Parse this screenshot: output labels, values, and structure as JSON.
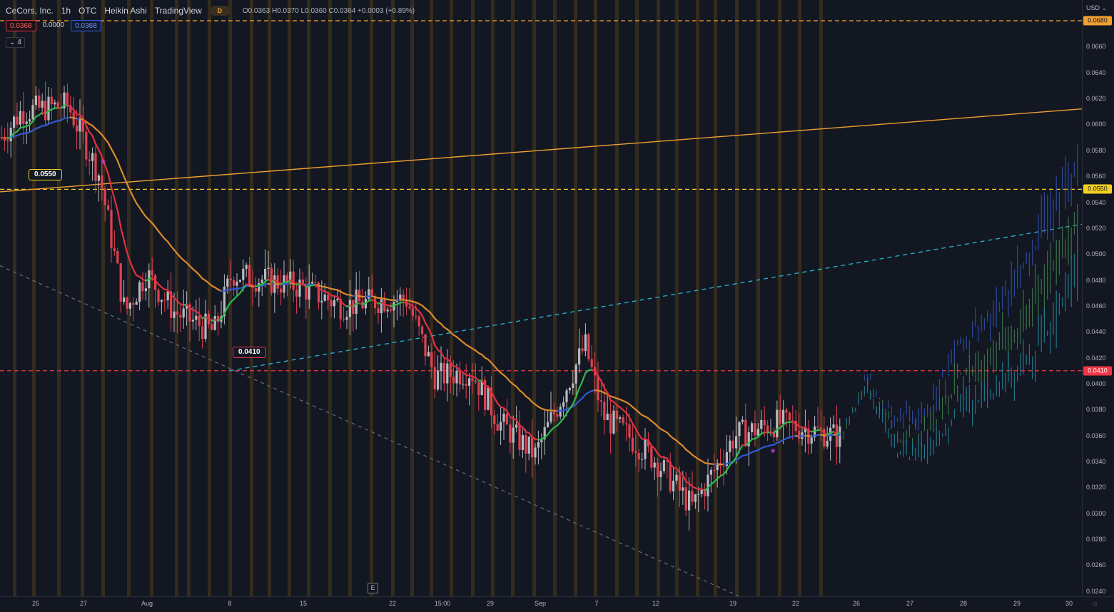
{
  "header": {
    "symbol": "CeCors, Inc.",
    "interval": "1h",
    "exchange": "OTC",
    "chart_type": "Heikin Ashi",
    "source": "TradingView",
    "delayed_badge": "D",
    "ohlc": "O0.0363 H0.0370 L0.0360 C0.0364 +0.0003 (+0.89%)"
  },
  "indicator_row": {
    "value_red": "0.0368",
    "value_plain": "0.0000",
    "value_blue": "0.0368",
    "collapse_count": "4"
  },
  "price_axis": {
    "currency": "USD",
    "ticks": [
      "0.0660",
      "0.0640",
      "0.0620",
      "0.0600",
      "0.0580",
      "0.0560",
      "0.0540",
      "0.0520",
      "0.0500",
      "0.0480",
      "0.0460",
      "0.0440",
      "0.0420",
      "0.0400",
      "0.0380",
      "0.0360",
      "0.0340",
      "0.0320",
      "0.0300",
      "0.0280",
      "0.0260",
      "0.0240"
    ],
    "badges": [
      {
        "value": "0.0680",
        "bg": "#f0a030",
        "fg": "#131722"
      },
      {
        "value": "0.0550",
        "bg": "#f5d020",
        "fg": "#131722"
      },
      {
        "value": "0.0410",
        "bg": "#f23645",
        "fg": "#ffffff"
      }
    ]
  },
  "time_axis": {
    "ticks": [
      "25",
      "27",
      "Aug",
      "8",
      "15",
      "22",
      "15:00",
      "29",
      "Sep",
      "7",
      "12",
      "19",
      "22",
      "26",
      "27",
      "28",
      "29",
      "30"
    ]
  },
  "annotations": {
    "label_high": "0.0550",
    "label_low": "0.0410",
    "earnings_marker": "E"
  },
  "colors": {
    "background": "#131722",
    "bull_candle": "#b7b9c0",
    "bear_candle": "#e0414f",
    "ema_fast_up": "#2fb94a",
    "ema_fast_down": "#e03040",
    "ema_slow_down": "#d98a2a",
    "ema_slow_up": "#3158d4",
    "trendline_orange": "#f0a030",
    "trendline_cyan": "#26b8d6",
    "support_red": "#f23645",
    "resistance_yellow": "#f5d020",
    "session_band": "#3a2f1c"
  },
  "chart_data": {
    "type": "candlestick",
    "title": "CeCors, Inc. 1h OTC Heikin Ashi",
    "ylabel": "USD",
    "ylim": [
      0.0236,
      0.0696
    ],
    "x_ticks": [
      "25",
      "27",
      "Aug",
      "8",
      "15",
      "22",
      "15:00",
      "29",
      "Sep",
      "7",
      "12",
      "19",
      "22",
      "26",
      "27",
      "28",
      "29",
      "30"
    ],
    "horizontal_levels": [
      {
        "value": 0.068,
        "style": "dashed",
        "color": "#f0a030"
      },
      {
        "value": 0.055,
        "style": "dashed",
        "color": "#f5d020"
      },
      {
        "value": 0.041,
        "style": "dashed",
        "color": "#f23645"
      }
    ],
    "trendlines": [
      {
        "from": [
          "25",
          0.055
        ],
        "to": [
          "30",
          0.0612
        ],
        "color": "#f0a030",
        "style": "solid"
      },
      {
        "from": [
          "8",
          0.041
        ],
        "to": [
          "30",
          0.0523
        ],
        "color": "#26b8d6",
        "style": "dashed"
      },
      {
        "from": [
          "25",
          0.0491
        ],
        "to": [
          "19",
          0.0235
        ],
        "color": "#6b6e78",
        "style": "dashed"
      }
    ],
    "close_waypoints": [
      [
        "25",
        0.059
      ],
      [
        "26",
        0.061
      ],
      [
        "27",
        0.0615
      ],
      [
        "28",
        0.056
      ],
      [
        "Aug",
        0.0455
      ],
      [
        "3",
        0.0485
      ],
      [
        "5",
        0.0455
      ],
      [
        "8",
        0.044
      ],
      [
        "10",
        0.0485
      ],
      [
        "15",
        0.0475
      ],
      [
        "18",
        0.046
      ],
      [
        "22",
        0.0465
      ],
      [
        "24",
        0.0465
      ],
      [
        "15:00",
        0.0405
      ],
      [
        "27",
        0.041
      ],
      [
        "29",
        0.037
      ],
      [
        "Sep",
        0.0345
      ],
      [
        "5",
        0.043
      ],
      [
        "7",
        0.0375
      ],
      [
        "10",
        0.036
      ],
      [
        "14",
        0.034
      ],
      [
        "17",
        0.0305
      ],
      [
        "19",
        0.036
      ],
      [
        "22",
        0.037
      ],
      [
        "24",
        0.036
      ]
    ],
    "projection_waypoints": [
      [
        "26",
        0.036
      ],
      [
        "26.5",
        0.0395
      ],
      [
        "27",
        0.035
      ],
      [
        "27.5",
        0.0345
      ],
      [
        "28",
        0.038
      ],
      [
        "28.7",
        0.0395
      ],
      [
        "29.3",
        0.042
      ],
      [
        "30",
        0.048
      ]
    ]
  }
}
